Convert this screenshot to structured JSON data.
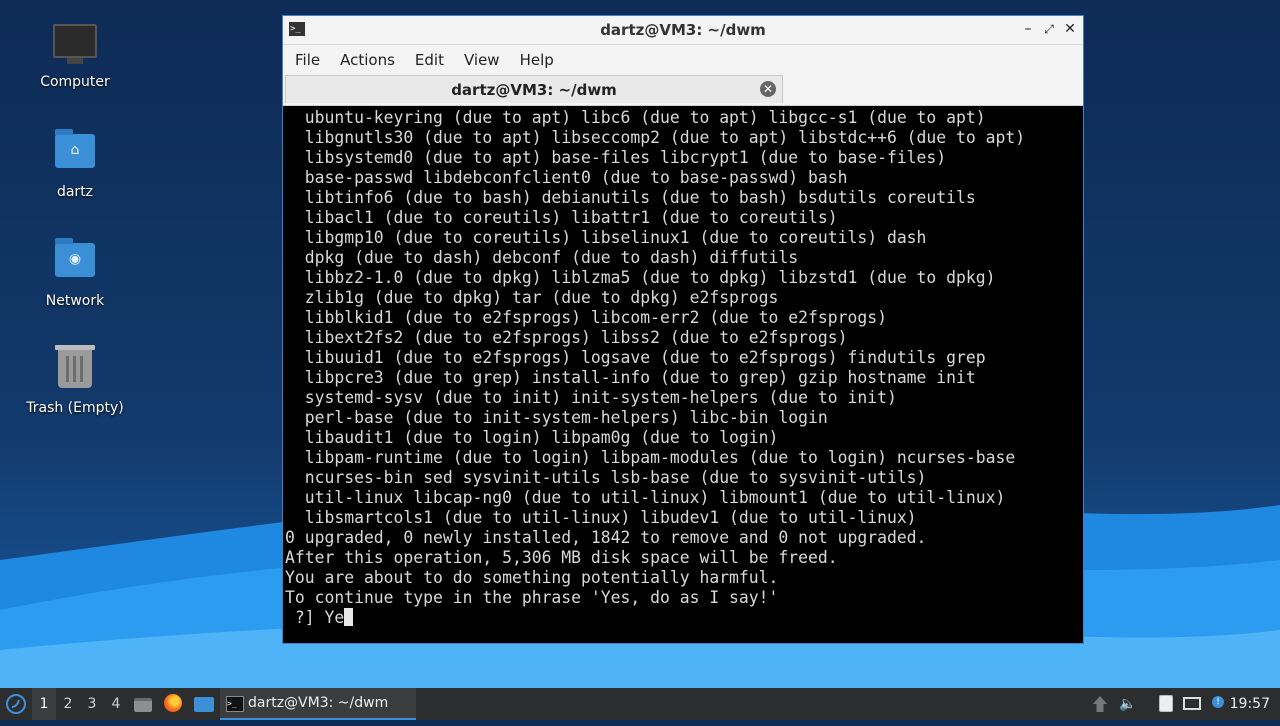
{
  "desktop": {
    "icons": [
      {
        "label": "Computer",
        "icon": "computer-icon"
      },
      {
        "label": "dartz",
        "icon": "home-folder-icon"
      },
      {
        "label": "Network",
        "icon": "network-folder-icon"
      },
      {
        "label": "Trash (Empty)",
        "icon": "trash-icon"
      }
    ]
  },
  "window": {
    "title": "dartz@VM3: ~/dwm",
    "controls": {
      "minimize": "–",
      "maximize": "⤢",
      "close": "✕"
    },
    "menu": [
      "File",
      "Actions",
      "Edit",
      "View",
      "Help"
    ],
    "tab": {
      "title": "dartz@VM3: ~/dwm",
      "close": "✕"
    }
  },
  "terminal": {
    "lines": [
      "  ubuntu-keyring (due to apt) libc6 (due to apt) libgcc-s1 (due to apt)",
      "  libgnutls30 (due to apt) libseccomp2 (due to apt) libstdc++6 (due to apt)",
      "  libsystemd0 (due to apt) base-files libcrypt1 (due to base-files)",
      "  base-passwd libdebconfclient0 (due to base-passwd) bash",
      "  libtinfo6 (due to bash) debianutils (due to bash) bsdutils coreutils",
      "  libacl1 (due to coreutils) libattr1 (due to coreutils)",
      "  libgmp10 (due to coreutils) libselinux1 (due to coreutils) dash",
      "  dpkg (due to dash) debconf (due to dash) diffutils",
      "  libbz2-1.0 (due to dpkg) liblzma5 (due to dpkg) libzstd1 (due to dpkg)",
      "  zlib1g (due to dpkg) tar (due to dpkg) e2fsprogs",
      "  libblkid1 (due to e2fsprogs) libcom-err2 (due to e2fsprogs)",
      "  libext2fs2 (due to e2fsprogs) libss2 (due to e2fsprogs)",
      "  libuuid1 (due to e2fsprogs) logsave (due to e2fsprogs) findutils grep",
      "  libpcre3 (due to grep) install-info (due to grep) gzip hostname init",
      "  systemd-sysv (due to init) init-system-helpers (due to init)",
      "  perl-base (due to init-system-helpers) libc-bin login",
      "  libaudit1 (due to login) libpam0g (due to login)",
      "  libpam-runtime (due to login) libpam-modules (due to login) ncurses-base",
      "  ncurses-bin sed sysvinit-utils lsb-base (due to sysvinit-utils)",
      "  util-linux libcap-ng0 (due to util-linux) libmount1 (due to util-linux)",
      "  libsmartcols1 (due to util-linux) libudev1 (due to util-linux)",
      "0 upgraded, 0 newly installed, 1842 to remove and 0 not upgraded.",
      "After this operation, 5,306 MB disk space will be freed.",
      "You are about to do something potentially harmful.",
      "To continue type in the phrase 'Yes, do as I say!'"
    ],
    "prompt": " ?] Ye"
  },
  "taskbar": {
    "workspaces": [
      "1",
      "2",
      "3",
      "4"
    ],
    "active_workspace": "1",
    "launchers": [
      "file-manager-icon",
      "firefox-icon",
      "desktop-icon"
    ],
    "task_label": "dartz@VM3: ~/dwm",
    "tray": [
      "update-icon",
      "volume-icon",
      "clipboard-icon",
      "network-icon",
      "notification-icon"
    ],
    "clock": "19:57"
  },
  "colors": {
    "accent": "#3d8fd8",
    "terminal_bg": "#000000",
    "terminal_fg": "#d8d8d8"
  }
}
